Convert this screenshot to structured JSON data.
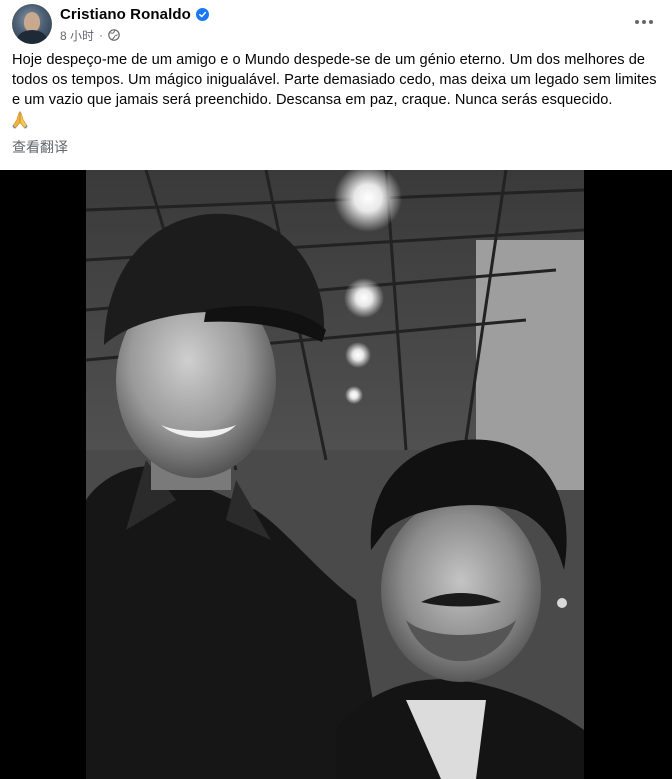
{
  "post": {
    "author": "Cristiano Ronaldo",
    "timestamp": "8 小时",
    "text": "Hoje despeço-me de um amigo e o Mundo despede-se de um génio eterno. Um dos melhores de todos os tempos. Um mágico inigualável. Parte demasiado cedo, mas deixa um legado sem limites e um vazio que jamais será preenchido. Descansa em paz, craque. Nunca serás esquecido.",
    "emoji": "🙏",
    "see_translation": "查看翻译"
  },
  "icons": {
    "verified": "verified-badge-icon",
    "privacy": "globe-icon",
    "more": "more-options-icon",
    "reaction": "folded-hands-emoji"
  },
  "colors": {
    "verified_blue": "#1877f2",
    "meta_gray": "#65676b",
    "photo_letterbox": "#000000"
  }
}
